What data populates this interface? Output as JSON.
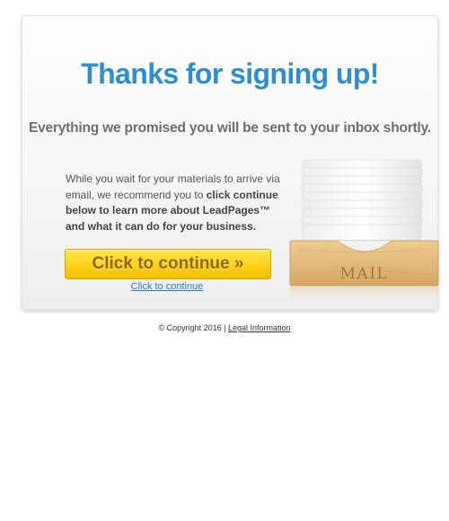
{
  "page": {
    "title": "Thanks for signing up!",
    "subtitle": "Everything we promised you will be sent to your inbox shortly.",
    "body": {
      "intro": "While you wait for your materials to arrive via email, we recommend you to ",
      "emphasis": "click continue below to learn more about LeadPages™ and what it can do for your business."
    },
    "cta_button_label": "Click to continue »",
    "cta_link_label": "Click to continue",
    "illustration": {
      "label": "MAIL",
      "icon": "mail-tray-icon"
    }
  },
  "footer": {
    "copyright": "© Copyright 2016 |",
    "legal_link": "Legal Information"
  },
  "colors": {
    "title_blue": "#2b8fd1",
    "button_yellow": "#ffd21a",
    "link_blue": "#2b7bc8"
  }
}
